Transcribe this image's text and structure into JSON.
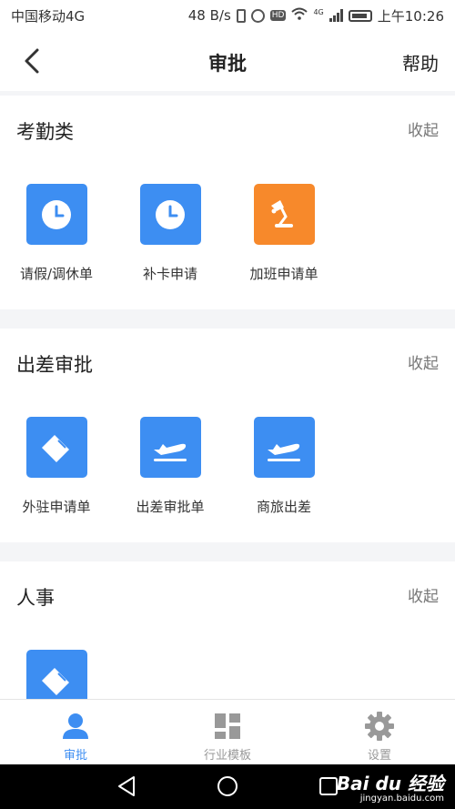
{
  "status_bar": {
    "carrier": "中国移动4G",
    "speed": "48 B/s",
    "hd": "HD",
    "net": "4G",
    "time": "上午10:26"
  },
  "nav": {
    "title": "审批",
    "help": "帮助"
  },
  "sections": [
    {
      "title": "考勤类",
      "collapse": "收起",
      "apps": [
        {
          "label": "请假/调休单",
          "icon": "clock-icon",
          "color": "#3d8ef2"
        },
        {
          "label": "补卡申请",
          "icon": "clock-icon",
          "color": "#3d8ef2"
        },
        {
          "label": "加班申请单",
          "icon": "desk-lamp-icon",
          "color": "#f7892b"
        }
      ]
    },
    {
      "title": "出差审批",
      "collapse": "收起",
      "apps": [
        {
          "label": "外驻申请单",
          "icon": "handshake-icon",
          "color": "#3d8ef2"
        },
        {
          "label": "出差审批单",
          "icon": "airplane-icon",
          "color": "#3d8ef2"
        },
        {
          "label": "商旅出差",
          "icon": "airplane-icon",
          "color": "#3d8ef2"
        }
      ]
    },
    {
      "title": "人事",
      "collapse": "收起",
      "apps": [
        {
          "icon": "handshake-icon",
          "color": "#3d8ef2"
        }
      ]
    }
  ],
  "tabs": [
    {
      "label": "审批",
      "icon": "person-icon",
      "active": true
    },
    {
      "label": "行业模板",
      "icon": "grid-icon",
      "active": false
    },
    {
      "label": "设置",
      "icon": "gear-icon",
      "active": false
    }
  ],
  "watermark": {
    "main": "Bai du 经验",
    "sub": "jingyan.baidu.com"
  }
}
